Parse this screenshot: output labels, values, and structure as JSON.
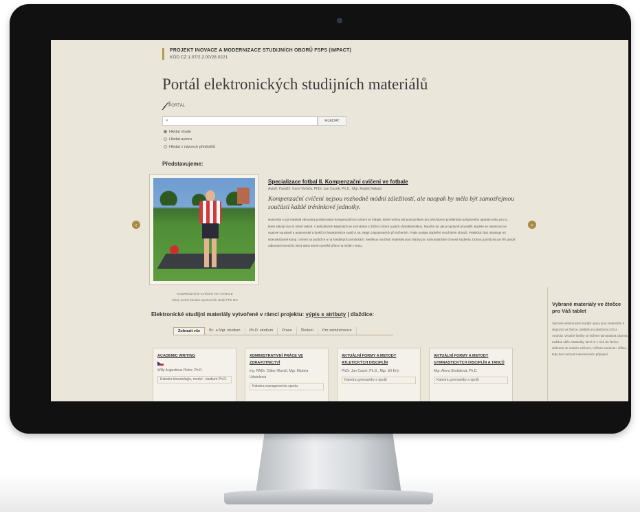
{
  "project": {
    "title": "PROJEKT INOVACE A MODERNIZACE STUDIJNÍCH OBORŮ FSPS (IMPACT)",
    "code": "KÓD CZ.1.07/2.2.00/28.0221"
  },
  "site_title": "Portál elektronických studijních materiálů",
  "brand_label": "PORTÁL",
  "search": {
    "button_label": "HLEDAT",
    "options": [
      "Hledat všude",
      "Hledat autora",
      "Hledat v názvech předmětů"
    ]
  },
  "featured": {
    "heading": "Představujeme:",
    "caption": [
      "KOMPENZAČNÍ CVIČENÍ VE FOTBALE",
      "Zdroj: archiv fotoabs sportovních studií FPS MU"
    ],
    "title": "Specializace fotbal II. Kompenzační cvičení ve fotbale",
    "authors": "Autoři: PaedDr. Karel Večeřa, PhDr. Jan Cacek, Ph.D., Mgr. Radek Nebula",
    "quote": "Kompenzační cvičení nejsou rozhodně módní záležitostí, ale naopak by měla být samozřejmou součástí každé tréninkové jednotky.",
    "body": "Nenechte si ujít materiál věnovaný problematice kompenzačních cvičení ve fotbale, které mohou být pomocníkem pro přecházení problémům pohybového aparátu nebo pro to, které stávají více či méně nekorl. V jednotlivých kapitolách se seznámíte s dílčím cvičení a jejich charakteristikou. Naučíte se, jak je správně provádět. Budete se orientovat ve svalové soustavě a anatomické a funkční charakteristice svalů a na, stegin zapojovaných při cvičeních. Popis ovaluje doplnění množstvím obrazů. Praktická část obsahuje 40 videoukázamě komp. cvičení na podložce a na švédských pomůckách. Nedílnou součástí materiálu jsou otázky pro samostatnické činnosti studenta. Dobrou pomůckou je též glosář odborných termínů, který daný termín vymíští přímo na místě v textu."
  },
  "materials": {
    "heading_pre": "Elektronické studijní materiály vytvořené v rámci projektu:",
    "link": "výpis s atributy",
    "heading_post": "| dlaždice:"
  },
  "tabs": [
    "Zobrazit vše",
    "Bc. a Mgr. studium",
    "Ph.D. studium",
    "Praxe",
    "Školení",
    "Pro zaměstnance"
  ],
  "cards": [
    {
      "title": "ACADEMIC WRITING",
      "flag": "uk-flag-icon",
      "author": "Willy Augustinus Pieter, Ph.D.",
      "dept": "Katedra kineziologie, modul - studium Ph.D."
    },
    {
      "title": "ADMINISTRATIVNÍ PRÁCE VE ZDRAVOTNICTVÍ",
      "author": "Ing. RNDr. Ctibor Hlaváč, Mgr. Martina Urbánková",
      "dept": "Katedra managementu sportu"
    },
    {
      "title": "AKTUÁLNÍ FORMY A METODY ATLETICKÝCH DISCIPLÍN",
      "author": "PhDr. Jan Cacek, Ph.D., Mgr. Jiří Erly",
      "dept": "Katedra gymnastiky a úpolů"
    },
    {
      "title": "AKTUÁLNÍ FORMY A METODY GYMNASTICKÝCH DISCIPLÍN A TANCŮ",
      "author": "Mgr. Alena Skotáková, Ph.D.",
      "dept": "Katedra gymnastiky a úpolů"
    }
  ],
  "sidebar": {
    "heading": "Vybrané materiály ve čtečce pro Váš tablet",
    "body": "Vybrané elektronické studijní opory jsou studentům k dispozici ve čtečce, ideálně pro platformu iOS a Android. Vhodné čtečky si můžete nainstalovat zdarma. Každou stiže. Materiály, které si z nich do čtečce stáhnete do našeho zařízení, můžete studovat i offline, tedy bez nutnosti internetového připojení."
  },
  "arrows": {
    "prev": "‹",
    "next": "›"
  }
}
